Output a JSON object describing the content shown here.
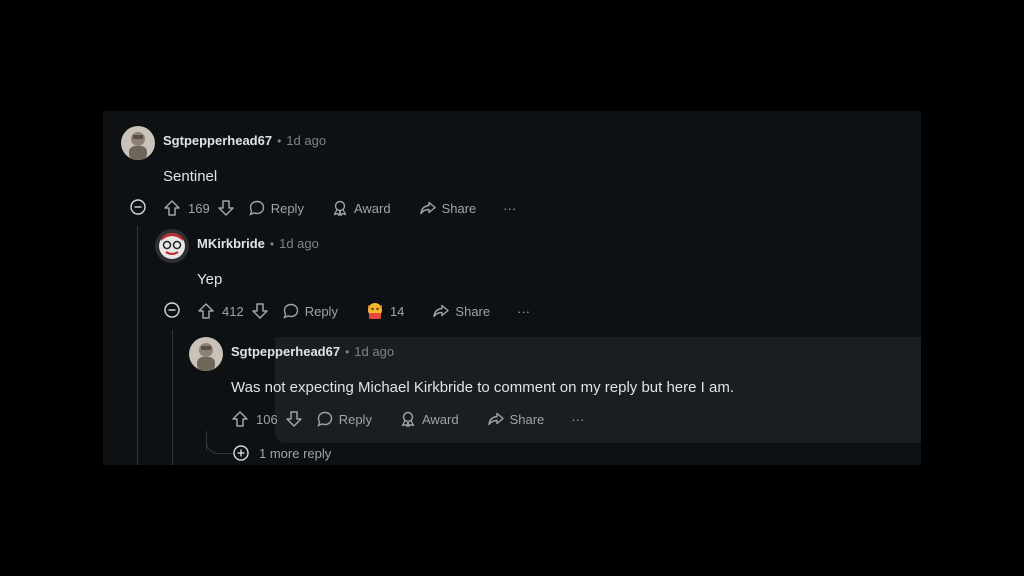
{
  "comments": [
    {
      "username": "Sgtpepperhead67",
      "separator": "•",
      "time": "1d ago",
      "body": "Sentinel",
      "score": "169",
      "reply_label": "Reply",
      "award_label": "Award",
      "share_label": "Share",
      "more_label": "···"
    },
    {
      "username": "MKirkbride",
      "separator": "•",
      "time": "1d ago",
      "body": "Yep",
      "score": "412",
      "reply_label": "Reply",
      "award_count": "14",
      "share_label": "Share",
      "more_label": "···"
    },
    {
      "username": "Sgtpepperhead67",
      "separator": "•",
      "time": "1d ago",
      "body": "Was not expecting Michael Kirkbride to comment on my reply but here I am.",
      "score": "106",
      "reply_label": "Reply",
      "award_label": "Award",
      "share_label": "Share",
      "more_label": "···"
    }
  ],
  "more_replies_label": "1 more reply",
  "colors": {
    "page_bg": "#000000",
    "panel_bg": "#0e1113",
    "highlight_bg": "#1a1e21",
    "thread_line": "#343536",
    "muted_text": "#818384",
    "action_text": "#9ea4a8",
    "body_text": "#e0e3e5"
  },
  "icons": [
    "upvote-icon",
    "downvote-icon",
    "reply-bubble-icon",
    "award-icon",
    "share-icon",
    "collapse-minus-icon",
    "expand-plus-icon",
    "award-emoji-icon"
  ]
}
